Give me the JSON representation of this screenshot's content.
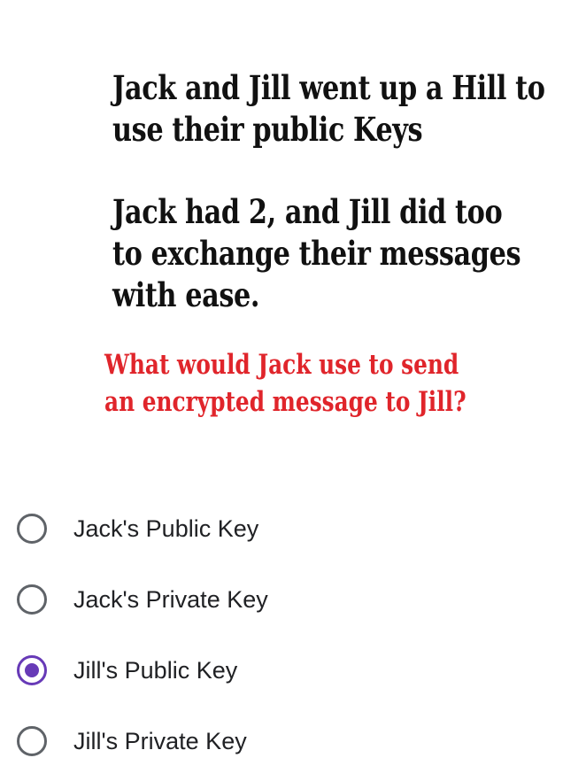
{
  "question": {
    "poem_stanza_1": [
      "Jack and Jill went up a Hill to",
      "use their public Keys"
    ],
    "poem_stanza_2": [
      "Jack had 2, and Jill did too",
      "to exchange their messages",
      "with ease."
    ],
    "prompt": [
      "What would Jack use to send",
      "an encrypted message to Jill?"
    ]
  },
  "options": [
    {
      "label": "Jack's Public Key",
      "selected": false
    },
    {
      "label": "Jack's Private Key",
      "selected": false
    },
    {
      "label": "Jill's Public Key",
      "selected": true
    },
    {
      "label": "Jill's Private Key",
      "selected": false
    }
  ],
  "colors": {
    "accent": "#673ab7",
    "prompt_text": "#e0252b",
    "radio_border": "#5f6368",
    "body_text": "#202124"
  }
}
